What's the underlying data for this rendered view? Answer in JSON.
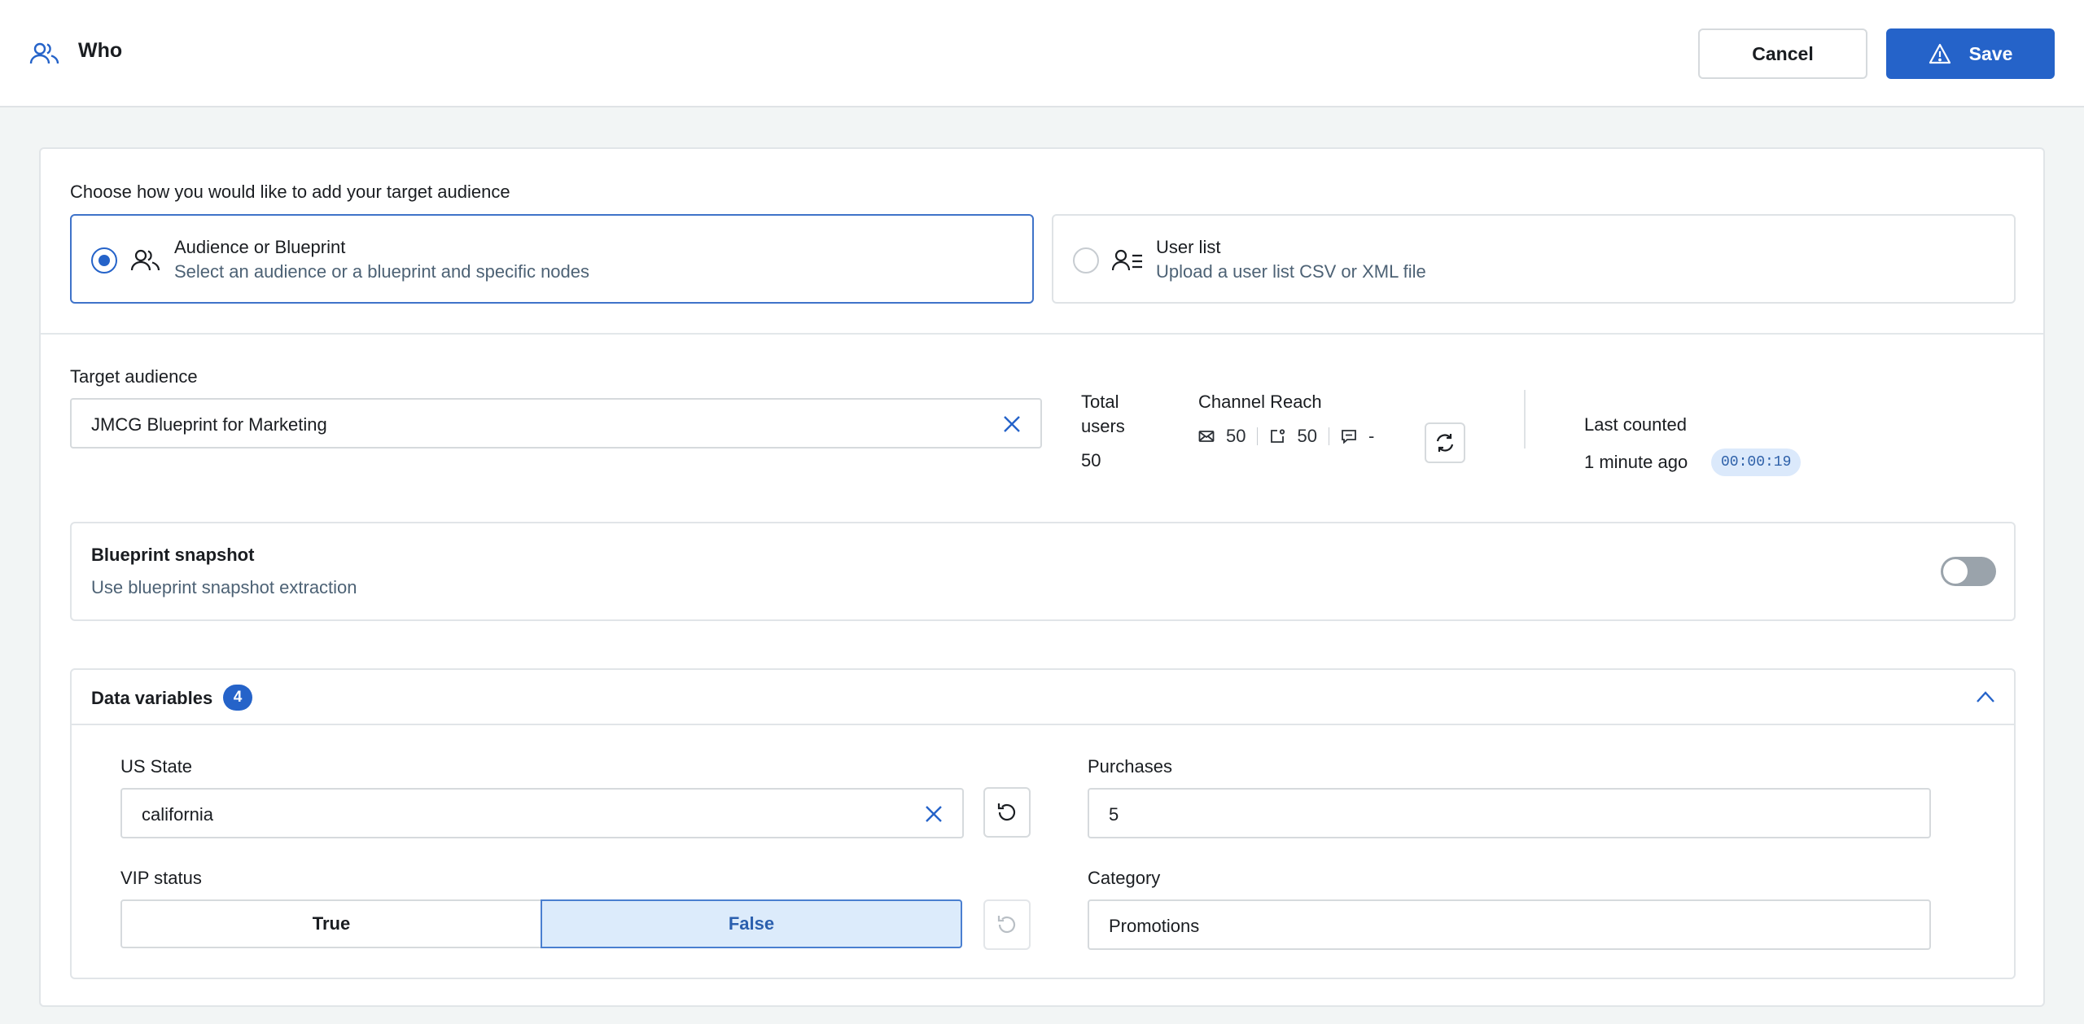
{
  "header": {
    "title": "Who",
    "cancel_label": "Cancel",
    "save_label": "Save"
  },
  "audience_choice": {
    "prompt": "Choose how you would like to add your target audience",
    "options": [
      {
        "title": "Audience or Blueprint",
        "description": "Select an audience or a blueprint and specific nodes",
        "selected": true
      },
      {
        "title": "User list",
        "description": "Upload a user list CSV or XML file",
        "selected": false
      }
    ]
  },
  "target": {
    "label": "Target audience",
    "value": "JMCG Blueprint for Marketing",
    "total_users_label": "Total users",
    "total_users": "50",
    "channel_reach_label": "Channel Reach",
    "reach": {
      "email": "50",
      "push": "50",
      "sms": "-"
    },
    "last_counted_label": "Last counted",
    "last_counted": "1 minute ago",
    "elapsed": "00:00:19"
  },
  "snapshot": {
    "title": "Blueprint snapshot",
    "description": "Use blueprint snapshot extraction",
    "enabled": false
  },
  "variables": {
    "title": "Data variables",
    "count": "4",
    "us_state_label": "US State",
    "us_state_value": "california",
    "purchases_label": "Purchases",
    "purchases_value": "5",
    "vip_label": "VIP status",
    "vip_true": "True",
    "vip_false": "False",
    "vip_selected": "False",
    "category_label": "Category",
    "category_value": "Promotions"
  },
  "colors": {
    "accent": "#2563c9",
    "muted_text": "#4d6275",
    "background": "#f2f5f5"
  }
}
